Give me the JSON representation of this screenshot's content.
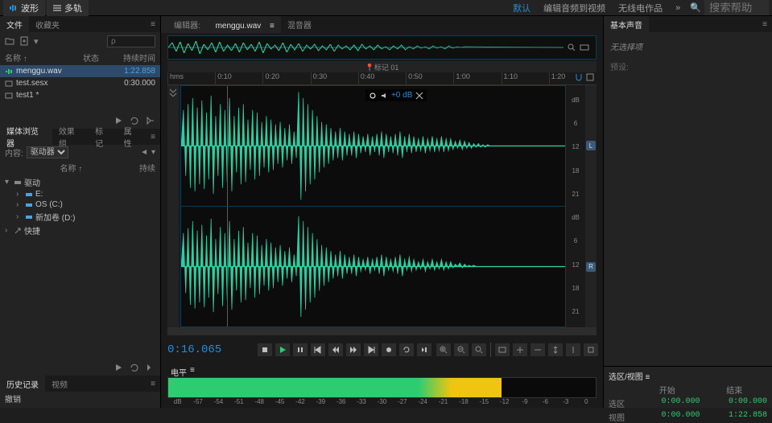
{
  "topbar": {
    "mode_waveform": "波形",
    "mode_multitrack": "多轨",
    "links": [
      "默认",
      "编辑音频到视频",
      "无线电作品"
    ],
    "search_placeholder": "搜索帮助"
  },
  "files_panel": {
    "tabs": [
      "文件",
      "收藏夹"
    ],
    "headers": {
      "name": "名称 ↑",
      "status": "状态",
      "duration": "持续时间"
    },
    "rows": [
      {
        "name": "menggu.wav",
        "duration": "1:22.858",
        "selected": true
      },
      {
        "name": "test.sesx",
        "duration": "0:30.000",
        "selected": false
      },
      {
        "name": "test1 *",
        "duration": "",
        "selected": false
      }
    ]
  },
  "media_panel": {
    "tabs": [
      "媒体浏览器",
      "效果组",
      "标记",
      "属性"
    ],
    "content_label": "内容:",
    "dropdown": "驱动器",
    "col_name": "名称 ↑",
    "col_dur": "持续",
    "tree": [
      {
        "label": "驱动",
        "depth": 0
      },
      {
        "label": "E:",
        "depth": 1
      },
      {
        "label": "OS (C:)",
        "depth": 1
      },
      {
        "label": "新加卷 (D:)",
        "depth": 1
      },
      {
        "label": "快捷",
        "depth": 0
      }
    ]
  },
  "history_panel": {
    "tabs": [
      "历史记录",
      "视频"
    ],
    "item": "撤销"
  },
  "editor": {
    "tabs": {
      "editor": "编辑器:",
      "file": "menggu.wav",
      "mixer": "混音器"
    },
    "marker_label": "📍标记 01",
    "timeline": [
      "hms",
      "0:10",
      "0:20",
      "0:30",
      "0:40",
      "0:50",
      "1:00",
      "1:10",
      "1:20"
    ],
    "hud_db": "+0 dB",
    "db_scale": [
      "dB",
      "",
      "6",
      "",
      "12",
      "",
      "18",
      "",
      "21"
    ],
    "channels": [
      "L",
      "R"
    ],
    "timecode": "0:16.065"
  },
  "levels": {
    "title": "电平",
    "scale": [
      "dB",
      "-57",
      "-54",
      "-51",
      "-48",
      "-45",
      "-42",
      "-39",
      "-36",
      "-33",
      "-30",
      "-27",
      "-24",
      "-21",
      "-18",
      "-15",
      "-12",
      "-9",
      "-6",
      "-3",
      "0"
    ]
  },
  "essential": {
    "title": "基本声音",
    "empty": "无选择项",
    "preset_label": "预设:"
  },
  "selection": {
    "title": "选区/视图",
    "col_start": "开始",
    "col_end": "结束",
    "row_sel": "选区",
    "row_view": "视图",
    "sel_start": "0:00.000",
    "sel_end": "0:00.000",
    "view_start": "0:00.000",
    "view_end": "1:22.858"
  },
  "search_history_placeholder": "ρ"
}
